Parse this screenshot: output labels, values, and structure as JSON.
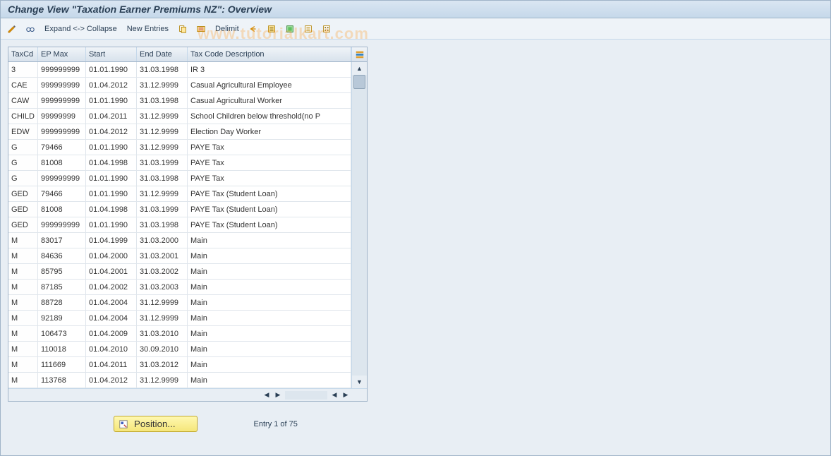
{
  "title": "Change View \"Taxation Earner Premiums NZ\": Overview",
  "toolbar": {
    "expand_collapse": "Expand <-> Collapse",
    "new_entries": "New Entries",
    "delimit": "Delimit"
  },
  "watermark": "www.tutorialkart.com",
  "columns": {
    "taxcd": "TaxCd",
    "epmax": "EP Max",
    "start": "Start",
    "end": "End Date",
    "desc": "Tax Code Description"
  },
  "rows": [
    {
      "taxcd": "3",
      "epmax": "999999999",
      "start": "01.01.1990",
      "end": "31.03.1998",
      "desc": "IR 3"
    },
    {
      "taxcd": "CAE",
      "epmax": "999999999",
      "start": "01.04.2012",
      "end": "31.12.9999",
      "desc": "Casual Agricultural Employee"
    },
    {
      "taxcd": "CAW",
      "epmax": "999999999",
      "start": "01.01.1990",
      "end": "31.03.1998",
      "desc": "Casual Agricultural Worker"
    },
    {
      "taxcd": "CHILD",
      "epmax": "99999999",
      "start": "01.04.2011",
      "end": "31.12.9999",
      "desc": "School Children below threshold(no P"
    },
    {
      "taxcd": "EDW",
      "epmax": "999999999",
      "start": "01.04.2012",
      "end": "31.12.9999",
      "desc": "Election Day Worker"
    },
    {
      "taxcd": "G",
      "epmax": "79466",
      "start": "01.01.1990",
      "end": "31.12.9999",
      "desc": "PAYE Tax"
    },
    {
      "taxcd": "G",
      "epmax": "81008",
      "start": "01.04.1998",
      "end": "31.03.1999",
      "desc": "PAYE Tax"
    },
    {
      "taxcd": "G",
      "epmax": "999999999",
      "start": "01.01.1990",
      "end": "31.03.1998",
      "desc": "PAYE Tax"
    },
    {
      "taxcd": "GED",
      "epmax": "79466",
      "start": "01.01.1990",
      "end": "31.12.9999",
      "desc": "PAYE Tax (Student Loan)"
    },
    {
      "taxcd": "GED",
      "epmax": "81008",
      "start": "01.04.1998",
      "end": "31.03.1999",
      "desc": "PAYE Tax (Student Loan)"
    },
    {
      "taxcd": "GED",
      "epmax": "999999999",
      "start": "01.01.1990",
      "end": "31.03.1998",
      "desc": "PAYE Tax (Student Loan)"
    },
    {
      "taxcd": "M",
      "epmax": "83017",
      "start": "01.04.1999",
      "end": "31.03.2000",
      "desc": "Main"
    },
    {
      "taxcd": "M",
      "epmax": "84636",
      "start": "01.04.2000",
      "end": "31.03.2001",
      "desc": "Main"
    },
    {
      "taxcd": "M",
      "epmax": "85795",
      "start": "01.04.2001",
      "end": "31.03.2002",
      "desc": "Main"
    },
    {
      "taxcd": "M",
      "epmax": "87185",
      "start": "01.04.2002",
      "end": "31.03.2003",
      "desc": "Main"
    },
    {
      "taxcd": "M",
      "epmax": "88728",
      "start": "01.04.2004",
      "end": "31.12.9999",
      "desc": "Main"
    },
    {
      "taxcd": "M",
      "epmax": "92189",
      "start": "01.04.2004",
      "end": "31.12.9999",
      "desc": "Main"
    },
    {
      "taxcd": "M",
      "epmax": "106473",
      "start": "01.04.2009",
      "end": "31.03.2010",
      "desc": "Main"
    },
    {
      "taxcd": "M",
      "epmax": "110018",
      "start": "01.04.2010",
      "end": "30.09.2010",
      "desc": "Main"
    },
    {
      "taxcd": "M",
      "epmax": "111669",
      "start": "01.04.2011",
      "end": "31.03.2012",
      "desc": "Main"
    },
    {
      "taxcd": "M",
      "epmax": "113768",
      "start": "01.04.2012",
      "end": "31.12.9999",
      "desc": "Main"
    }
  ],
  "footer": {
    "position_label": "Position...",
    "entry_label": "Entry 1 of 75"
  }
}
